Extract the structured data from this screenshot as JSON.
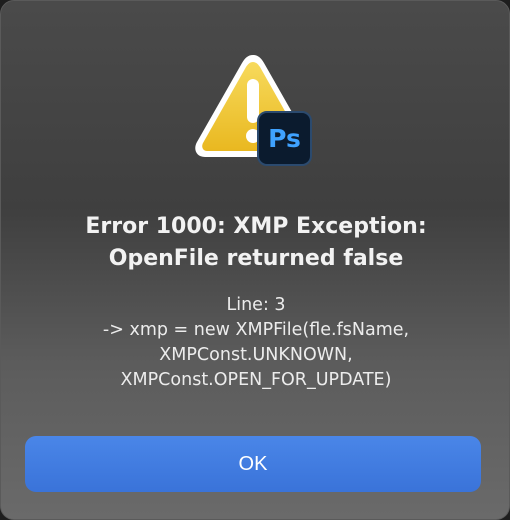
{
  "dialog": {
    "icon_badge": "Ps",
    "title_line1": "Error 1000: XMP Exception:",
    "title_line2": "OpenFile returned false",
    "message_lines": [
      "Line: 3",
      "->  xmp = new XMPFile(fle.fsName,",
      "XMPConst.UNKNOWN,",
      "XMPConst.OPEN_FOR_UPDATE)"
    ],
    "ok_label": "OK",
    "icons": {
      "warning": "warning-triangle-icon",
      "app": "photoshop-icon"
    },
    "colors": {
      "button": "#3a78e0",
      "warning_fill": "#f2cb45",
      "ps_text": "#3fa2ff",
      "ps_bg": "#0b1b2e"
    }
  }
}
